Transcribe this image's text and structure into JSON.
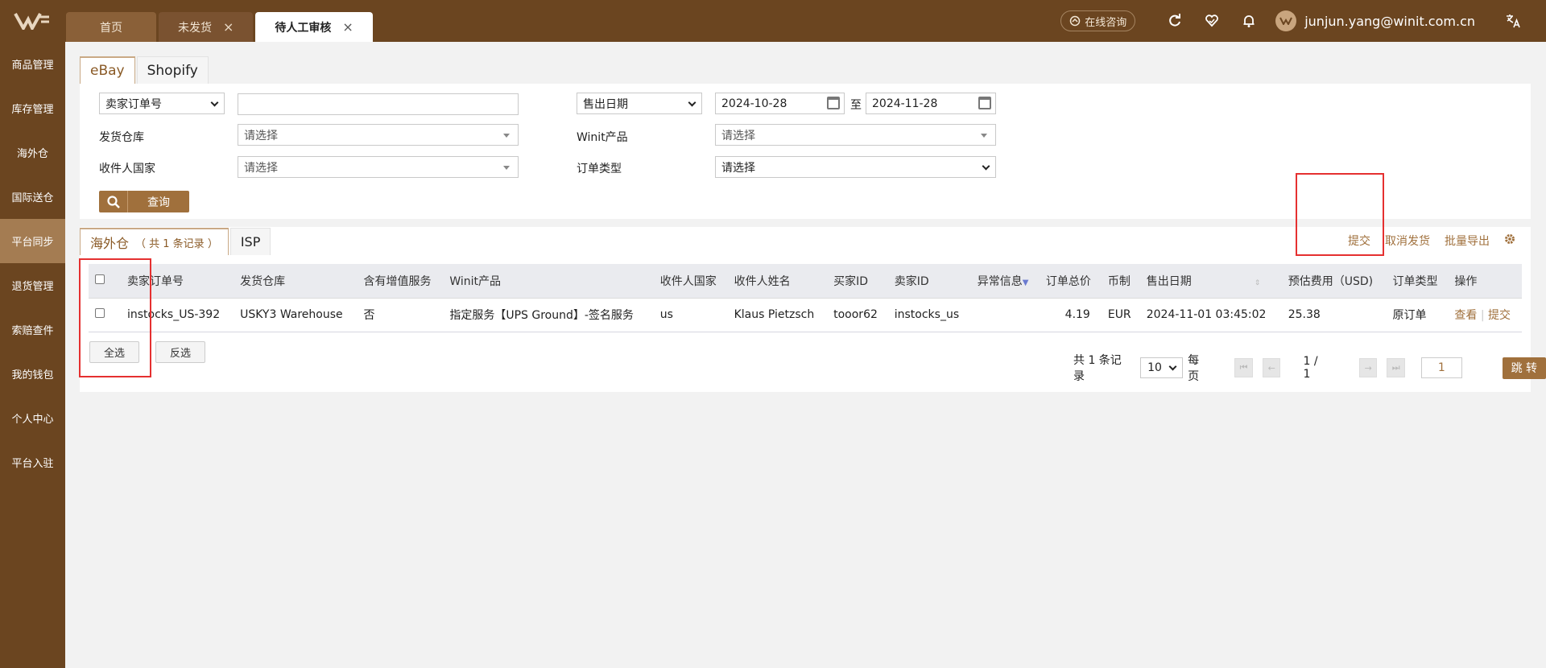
{
  "tabs": [
    {
      "label": "首页"
    },
    {
      "label": "未发货",
      "close": "×"
    },
    {
      "label": "待人工审核",
      "close": "×"
    }
  ],
  "topbar": {
    "consult": "在线咨询",
    "user_email": "junjun.yang@winit.com.cn"
  },
  "sidebar": {
    "items": [
      {
        "label": "商品管理"
      },
      {
        "label": "库存管理"
      },
      {
        "label": "海外仓"
      },
      {
        "label": "国际送仓"
      },
      {
        "label": "平台同步"
      },
      {
        "label": "退货管理"
      },
      {
        "label": "索赔查件"
      },
      {
        "label": "我的钱包"
      },
      {
        "label": "个人中心"
      },
      {
        "label": "平台入驻"
      }
    ]
  },
  "platform_tabs": [
    {
      "label": "eBay"
    },
    {
      "label": "Shopify"
    }
  ],
  "filters": {
    "order_type_select": "卖家订单号",
    "order_input": "",
    "date_select": "售出日期",
    "date_from": "2024-10-28",
    "date_to_sep": "至",
    "date_to": "2024-11-28",
    "warehouse_label": "发货仓库",
    "warehouse_value": "请选择",
    "product_label": "Winit产品",
    "product_value": "请选择",
    "country_label": "收件人国家",
    "country_value": "请选择",
    "ordertype_label": "订单类型",
    "ordertype_value": "请选择",
    "query_button": "查询"
  },
  "result_tabs": {
    "overseas": "海外仓",
    "overseas_count": "（ 共 1 条记录 ）",
    "isp": "ISP"
  },
  "actions": {
    "submit": "提交",
    "cancel_ship": "取消发货",
    "batch_export": "批量导出"
  },
  "table": {
    "headers": [
      "卖家订单号",
      "发货仓库",
      "含有增值服务",
      "Winit产品",
      "收件人国家",
      "收件人姓名",
      "买家ID",
      "卖家ID",
      "异常信息",
      "订单总价",
      "币制",
      "售出日期",
      "预估费用（USD)",
      "订单类型",
      "操作"
    ],
    "rows": [
      {
        "seller_order": "instocks_US-392",
        "warehouse": "USKY3 Warehouse",
        "vas": "否",
        "product": "指定服务【UPS Ground】-签名服务",
        "country": "us",
        "name": "Klaus Pietzsch",
        "buyer_id": "tooor62",
        "seller_id": "instocks_us",
        "exception": "",
        "total": "4.19",
        "currency": "EUR",
        "sold_date": "2024-11-01 03:45:02",
        "fee": "25.38",
        "order_type": "原订单",
        "op_view": "查看",
        "op_sep": "|",
        "op_submit": "提交"
      }
    ]
  },
  "select_all": "全选",
  "invert_select": "反选",
  "pager": {
    "total": "共 1 条记录",
    "page_size": "10",
    "per_page": "每页",
    "page_info": "1 / 1",
    "page_input": "1",
    "jump": "跳 转"
  },
  "colors": {
    "brand": "#6b4520",
    "accent": "#a0703c",
    "highlight": "#e53030"
  }
}
